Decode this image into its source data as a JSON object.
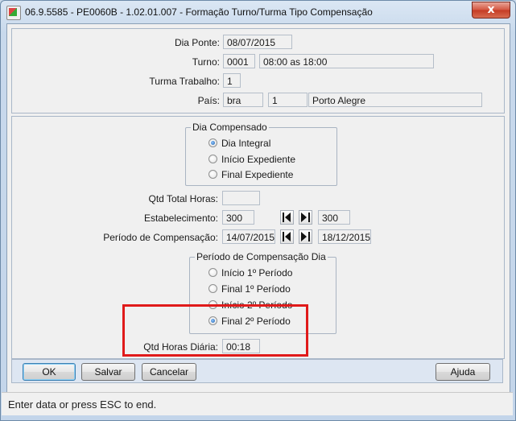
{
  "window": {
    "title": "06.9.5585 - PE0060B - 1.02.01.007 - Formação Turno/Turma Tipo Compensação",
    "close_glyph": "x"
  },
  "header": {
    "dia_ponte": {
      "label": "Dia Ponte:",
      "value": "08/07/2015"
    },
    "turno": {
      "label": "Turno:",
      "code": "0001",
      "description": "08:00 as 18:00"
    },
    "turma_trabalho": {
      "label": "Turma Trabalho:",
      "value": "1"
    },
    "pais": {
      "label": "País:",
      "code": "bra",
      "number": "1",
      "name": "Porto Alegre"
    }
  },
  "dia_compensado": {
    "legend": "Dia Compensado",
    "options": [
      {
        "label": "Dia Integral",
        "checked": true
      },
      {
        "label": "Início Expediente",
        "checked": false
      },
      {
        "label": "Final Expediente",
        "checked": false
      }
    ]
  },
  "fields": {
    "qtd_total_horas": {
      "label": "Qtd Total Horas:",
      "value": ""
    },
    "estabelecimento": {
      "label": "Estabelecimento:",
      "from": "300",
      "to": "300"
    },
    "periodo_compensacao": {
      "label": "Período de Compensação:",
      "from": "14/07/2015",
      "to": "18/12/2015"
    },
    "qtd_horas_diaria": {
      "label": "Qtd Horas Diária:",
      "value": "00:18"
    }
  },
  "periodo_dia": {
    "legend": "Período de Compensação Dia",
    "options": [
      {
        "label": "Início 1º Período",
        "checked": false
      },
      {
        "label": "Final 1º Período",
        "checked": false
      },
      {
        "label": "Início 2º Período",
        "checked": false
      },
      {
        "label": "Final 2º Período",
        "checked": true
      }
    ]
  },
  "buttons": {
    "ok": "OK",
    "salvar": "Salvar",
    "cancelar": "Cancelar",
    "ajuda": "Ajuda"
  },
  "status": {
    "text": "Enter data or press ESC to end."
  },
  "colors": {
    "highlight": "#e01a1a",
    "accent": "#3c7fb1"
  }
}
